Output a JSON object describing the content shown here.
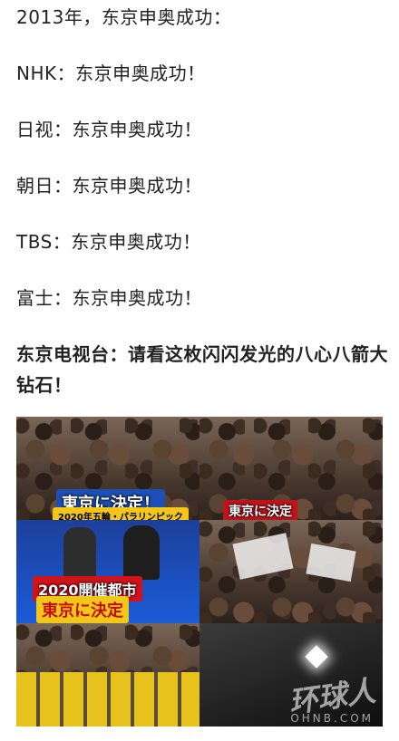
{
  "post": {
    "lines": [
      "2013年，东京申奥成功：",
      "NHK：东京申奥成功！",
      "日视：东京申奥成功！",
      "朝日：东京申奥成功！",
      "TBS：东京申奥成功！",
      "富士：东京申奥成功！"
    ],
    "bold_line": "东京电视台：请看这枚闪闪发光的八心八箭大钻石！"
  },
  "collage": {
    "captions": {
      "top_left_main": "東京に決定！",
      "top_left_sub": "2020年五輪・パラリンピック",
      "top_right_main": "東京に決定",
      "mid_left_main": "2020開催都市",
      "mid_left_sub": "東京に決定"
    },
    "watermark": "环球人",
    "watermark_sub": "OHNB.COM"
  }
}
